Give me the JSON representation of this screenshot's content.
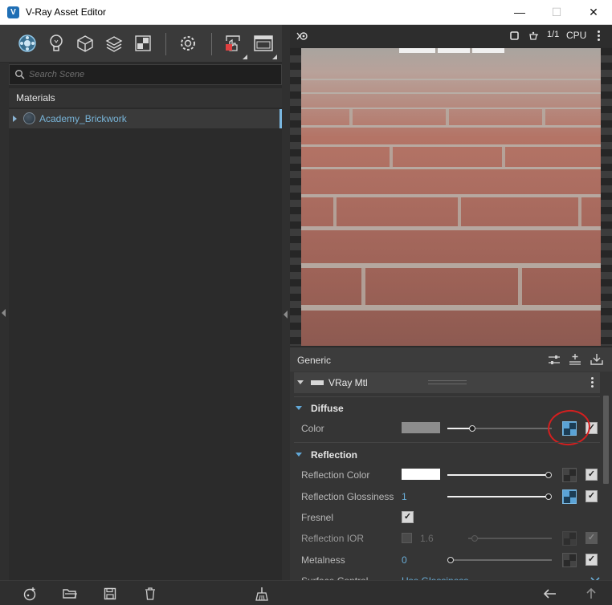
{
  "window": {
    "title": "V-Ray Asset Editor",
    "app_icon_glyph": "V",
    "minimize_glyph": "—",
    "maximize_glyph": "☐",
    "close_glyph": "✕"
  },
  "toolbar": {
    "icons": [
      "materials-icon",
      "lights-icon",
      "geometry-icon",
      "layers-icon",
      "textures-icon",
      "settings-icon",
      "render-interactive-icon",
      "frame-buffer-icon"
    ]
  },
  "search": {
    "placeholder": "Search Scene"
  },
  "materials": {
    "header": "Materials",
    "items": [
      {
        "name": "Academy_Brickwork"
      }
    ]
  },
  "preview_toolbar": {
    "render_mode_icon": "preview-scene-icon",
    "ratio_label": "1/1",
    "engine_label": "CPU"
  },
  "properties": {
    "generic_label": "Generic",
    "material_type": "VRay Mtl",
    "diffuse": {
      "section_label": "Diffuse",
      "color_label": "Color",
      "color_value": "#8c8c8c"
    },
    "reflection": {
      "section_label": "Reflection",
      "reflection_color_label": "Reflection Color",
      "reflection_color_value": "#ffffff",
      "reflection_glossiness_label": "Reflection Glossiness",
      "reflection_glossiness_value": "1",
      "fresnel_label": "Fresnel",
      "reflection_ior_label": "Reflection IOR",
      "reflection_ior_value": "1.6",
      "metalness_label": "Metalness",
      "metalness_value": "0",
      "surface_control_label": "Surface Control",
      "surface_control_value": "Use Glossiness"
    }
  },
  "colors": {
    "accent": "#5ba3d6",
    "highlight_circle": "#d41f1f",
    "link_text": "#78b4d8"
  }
}
